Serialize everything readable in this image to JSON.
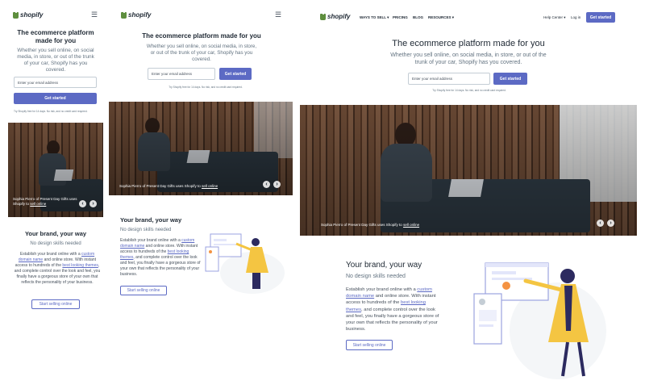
{
  "brand": {
    "name": "shopify",
    "accent": "#5c6ac4",
    "logo_green": "#5e8e3e"
  },
  "nav": {
    "items": [
      "WAYS TO SELL ▾",
      "PRICING",
      "BLOG",
      "RESOURCES ▾"
    ],
    "help": "Help Center ▾",
    "login": "Log in",
    "get_started": "Get started",
    "menu_icon": "hamburger-icon"
  },
  "hero": {
    "title": "The ecommerce platform made for you",
    "subtitle": "Whether you sell online, on social media, in store, or out of the trunk of your car, Shopify has you covered.",
    "email_placeholder": "Enter your email address",
    "cta": "Get started",
    "trial_note": "Try Shopify free for 14 days. No risk, and no credit card required."
  },
  "image_caption": {
    "prefix": "Sophia Pierro of Present Day Gifts uses Shopify to ",
    "link": "sell online",
    "prev": "‹",
    "next": "›"
  },
  "feature": {
    "title": "Your brand, your way",
    "subtitle": "No design skills needed",
    "body_1": "Establish your brand online with a ",
    "link_1": "custom domain name",
    "body_2": " and online store. With instant access to hundreds of the ",
    "link_2": "best looking themes",
    "body_3": ", and complete control over the look and feel, you finally have a gorgeous store of your own that reflects the personality of your business.",
    "button": "Start selling online"
  }
}
